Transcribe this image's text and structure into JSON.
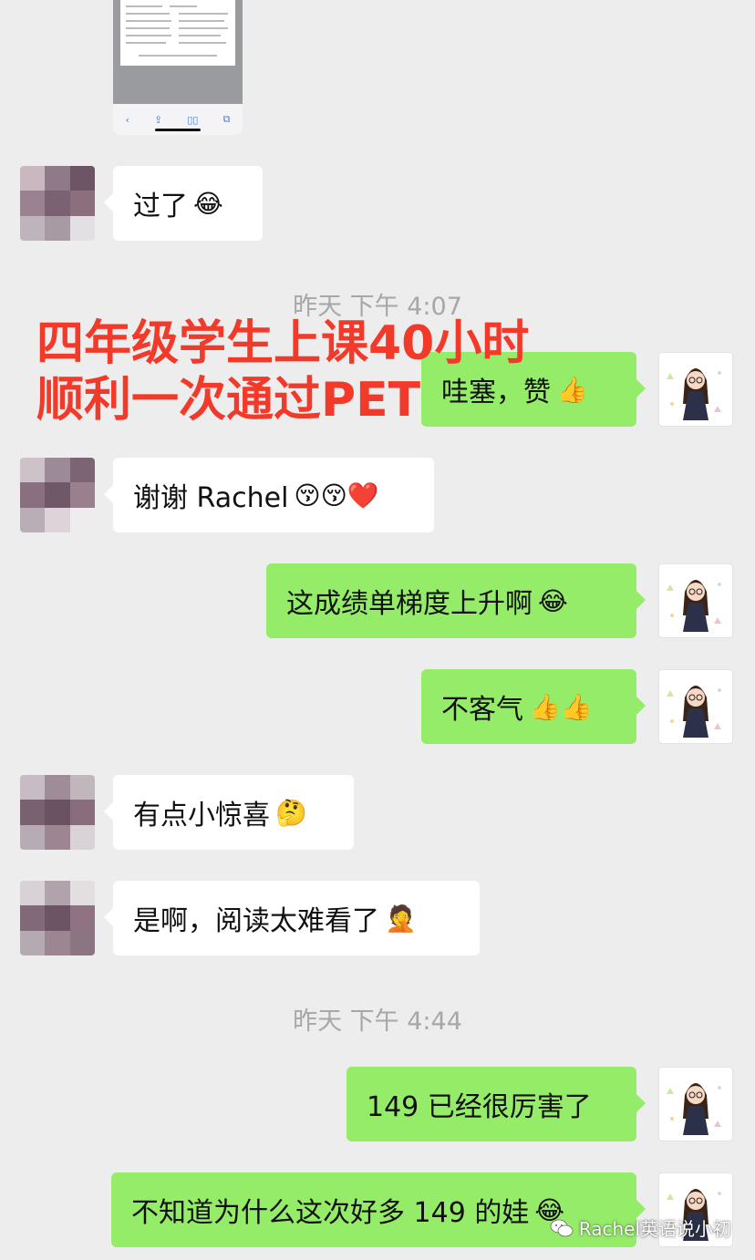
{
  "shared_image": {
    "nav_icons": [
      "‹",
      "⇪",
      "▯▯",
      "⧉"
    ]
  },
  "overlay_text": {
    "line1": "四年级学生上课40小时",
    "line2": "顺利一次通过PET"
  },
  "timestamps": [
    "昨天 下午 4:07",
    "昨天 下午 4:44"
  ],
  "messages": [
    {
      "side": "in",
      "text": "过了",
      "emoji": "😂"
    },
    {
      "side": "out",
      "text": "哇塞，赞",
      "emoji": "👍"
    },
    {
      "side": "in",
      "text": "谢谢 Rachel",
      "emoji": "😚😚❤️"
    },
    {
      "side": "out",
      "text": "这成绩单梯度上升啊",
      "emoji": "😂"
    },
    {
      "side": "out",
      "text": "不客气",
      "emoji": "👍👍"
    },
    {
      "side": "in",
      "text": "有点小惊喜",
      "emoji": "🤔"
    },
    {
      "side": "in",
      "text": "是啊，阅读太难看了",
      "emoji": "🤦"
    },
    {
      "side": "out",
      "text": "149 已经很厉害了",
      "emoji": ""
    },
    {
      "side": "out",
      "text": "不知道为什么这次好多 149 的娃",
      "emoji": "😂"
    }
  ],
  "watermark": {
    "icon": "wechat-icon",
    "text": "Rachel英语说小初"
  },
  "colors": {
    "background": "#ededed",
    "incoming_bubble": "#ffffff",
    "outgoing_bubble": "#95ec69",
    "overlay_text": "#f23a2a",
    "timestamp": "#a7a7a7"
  }
}
